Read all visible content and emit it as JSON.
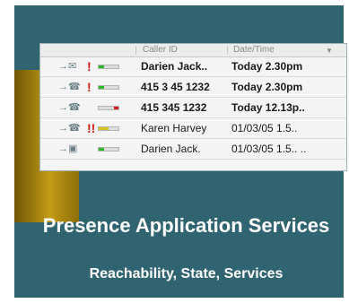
{
  "table": {
    "headers": {
      "caller_id": "Caller ID",
      "date_time": "Date/Time"
    },
    "rows": [
      {
        "direction_icon": "incoming-voicemail-icon",
        "priority": "!",
        "status_color": "#2eb82e",
        "status_fill": 0.25,
        "caller": "Darien Jack..",
        "date": "Today 2.30pm",
        "bold": true
      },
      {
        "direction_icon": "incoming-call-icon",
        "priority": "!",
        "status_color": "#2eb82e",
        "status_fill": 0.25,
        "caller": "415 3 45 1232",
        "date": "Today 2.30pm",
        "bold": true
      },
      {
        "direction_icon": "incoming-call-icon",
        "priority": "",
        "status_color": "#d22020",
        "status_fill": 0.25,
        "caller": "415 345 1232",
        "date": "Today 12.13p..",
        "bold": true
      },
      {
        "direction_icon": "incoming-call-icon",
        "priority": "!!",
        "status_color": "#d6c41e",
        "status_fill": 0.5,
        "caller": "Karen Harvey",
        "date": "01/03/05  1.5..",
        "bold": false
      },
      {
        "direction_icon": "incoming-video-icon",
        "priority": "",
        "status_color": "#2eb82e",
        "status_fill": 0.25,
        "caller": "Darien Jack.",
        "date": "01/03/05  1.5.. ..",
        "bold": false
      }
    ]
  },
  "title": "Presence Application Services",
  "subtitle": "Reachability, State, Services",
  "colors": {
    "background": "#2f6470",
    "accent_gold": "#c39b16",
    "priority_red": "#d21a10"
  }
}
